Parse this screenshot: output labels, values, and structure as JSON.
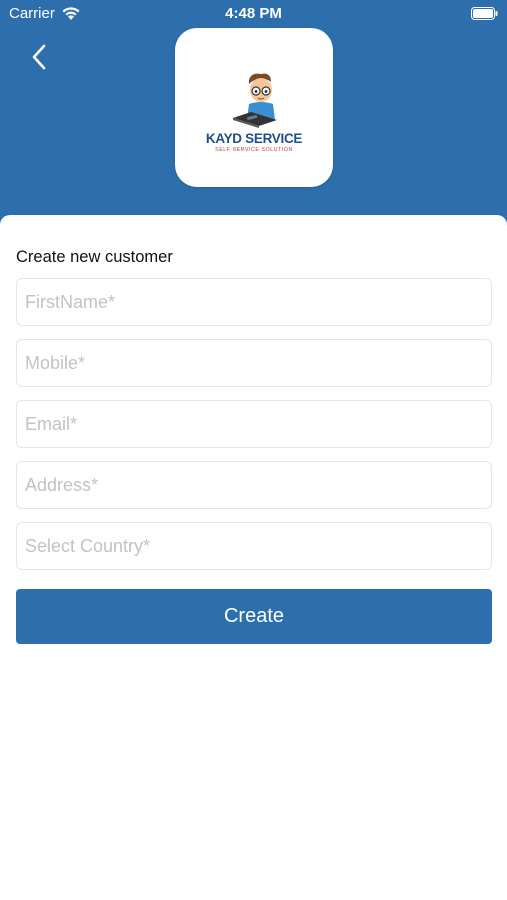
{
  "status_bar": {
    "carrier": "Carrier",
    "time": "4:48 PM"
  },
  "header": {
    "back_icon": "chevron-left-icon",
    "background_color": "#2d6fad"
  },
  "logo": {
    "brand": "KAYD SERVICE",
    "tagline": "SELF SERVICE SOLUTION"
  },
  "form": {
    "title": "Create new customer",
    "fields": [
      {
        "placeholder": "FirstName*",
        "value": ""
      },
      {
        "placeholder": "Mobile*",
        "value": ""
      },
      {
        "placeholder": "Email*",
        "value": ""
      },
      {
        "placeholder": "Address*",
        "value": ""
      },
      {
        "placeholder": "Select Country*",
        "value": ""
      }
    ],
    "submit_label": "Create"
  },
  "colors": {
    "primary": "#2d6fad",
    "placeholder": "#c2c2c8"
  }
}
